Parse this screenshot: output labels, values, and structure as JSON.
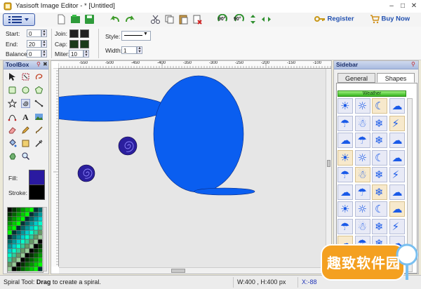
{
  "window": {
    "title": "Yasisoft Image Editor - * [Untitled]"
  },
  "toolbar": {
    "register_label": "Register",
    "buynow_label": "Buy Now",
    "rotate_label_1": "90°",
    "rotate_label_2": "90°"
  },
  "properties": {
    "start_label": "Start:",
    "start_value": "0",
    "end_label": "End:",
    "end_value": "20",
    "balance_label": "Balance:",
    "balance_value": "0",
    "join_label": "Join:",
    "cap_label": "Cap:",
    "miter_label": "Miter:",
    "miter_value": "10",
    "style_label": "Style:",
    "width_label": "Width:",
    "width_value": "1"
  },
  "toolbox": {
    "title": "ToolBox",
    "fill_label": "Fill:",
    "stroke_label": "Stroke:",
    "fill_color": "#2a1aa0",
    "stroke_color": "#000000"
  },
  "sidebar": {
    "title": "Sidebar",
    "tabs": [
      "General",
      "Shapes"
    ],
    "category": "Weather"
  },
  "ruler": {
    "top_ticks": [
      "-550",
      "-500",
      "-450",
      "-400",
      "-350",
      "-300",
      "-250",
      "-200",
      "-150",
      "-100"
    ],
    "left_ticks": [
      "-800",
      "-750",
      "-700",
      "-650",
      "-600",
      "-550",
      "-500",
      "-450"
    ]
  },
  "status": {
    "hint_prefix": "Spiral Tool: ",
    "hint_bold": "Drag",
    "hint_suffix": " to create a spiral.",
    "size": "W:400 , H:400 px",
    "x": "X:-88"
  },
  "watermark": {
    "text": "趣致软件园"
  },
  "colors": {
    "shape_blue": "#0a5ef0",
    "spiral_purple": "#2b1f9e",
    "accent_red_border": "#c00000"
  }
}
